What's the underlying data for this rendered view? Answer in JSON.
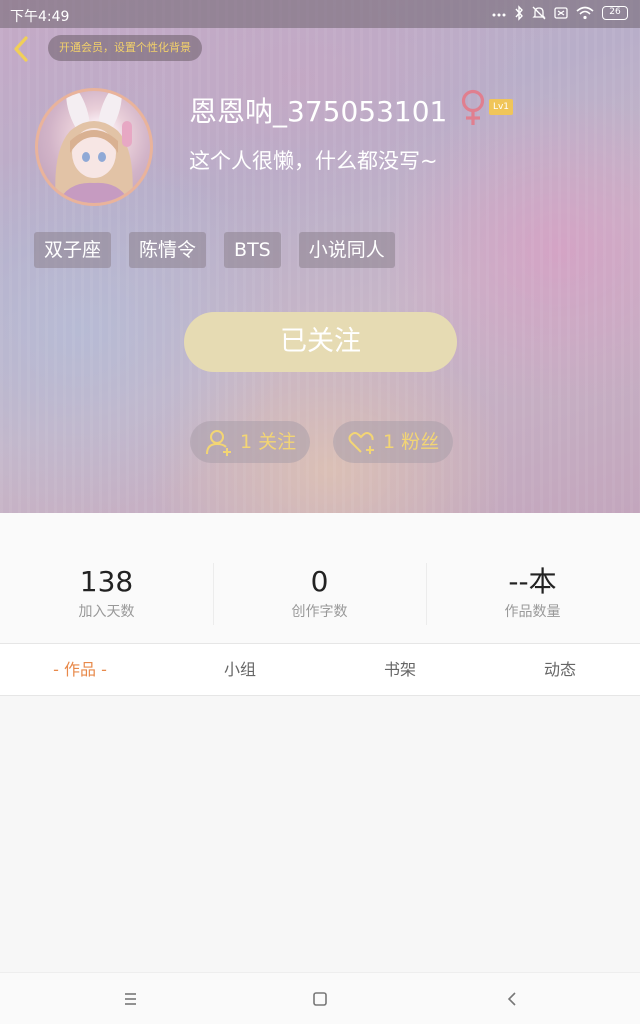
{
  "status_bar": {
    "time": "下午4:49",
    "battery": "26",
    "icons": [
      "dots-icon",
      "bluetooth-icon",
      "mute-icon",
      "sim-icon",
      "wifi-icon",
      "battery-icon"
    ]
  },
  "header": {
    "vip_prompt": "开通会员，设置个性化背景",
    "username": "恩恩呐_375053101",
    "level": "Lv1",
    "bio": "这个人很懒，什么都没写~",
    "tags": [
      "双子座",
      "陈情令",
      "BTS",
      "小说同人"
    ],
    "follow_button": "已关注",
    "following": "1 关注",
    "fans": "1 粉丝"
  },
  "stats": [
    {
      "value": "138",
      "label": "加入天数"
    },
    {
      "value": "0",
      "label": "创作字数"
    },
    {
      "value": "--本",
      "label": "作品数量"
    }
  ],
  "tabs": [
    {
      "label": "- 作品 -",
      "active": true
    },
    {
      "label": "小组",
      "active": false
    },
    {
      "label": "书架",
      "active": false
    },
    {
      "label": "动态",
      "active": false
    }
  ],
  "nav": [
    "menu-icon",
    "home-icon",
    "back-icon"
  ],
  "colors": {
    "accent_yellow": "#f3d574",
    "active_tab": "#e8894a",
    "follow_button_bg": "#e6dbb3",
    "female_icon": "#e07f8f",
    "level_badge": "#f0c559"
  }
}
